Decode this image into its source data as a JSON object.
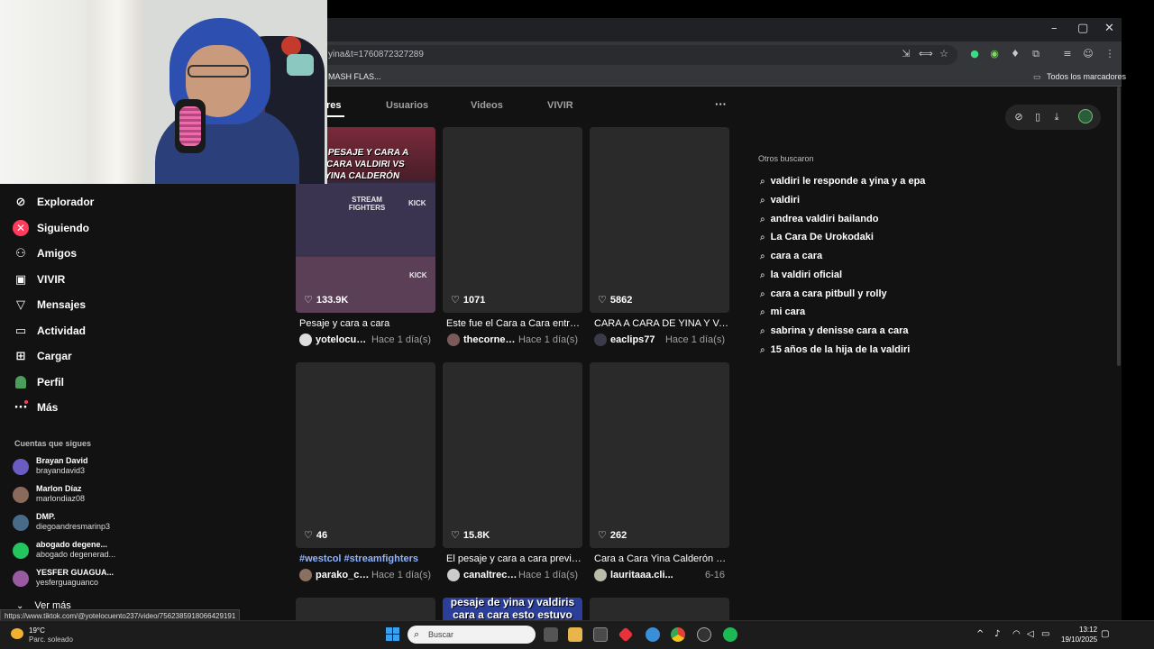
{
  "browser": {
    "url_fragment": "yina&t=1760872327289",
    "bookmark_left": "MASH FLAS...",
    "bookmark_right": "Todos los marcadores",
    "window_controls": [
      "–",
      "▢",
      "✕"
    ]
  },
  "tabs": [
    {
      "label": "res",
      "active": true
    },
    {
      "label": "Usuarios",
      "active": false
    },
    {
      "label": "Videos",
      "active": false
    },
    {
      "label": "VIVIR",
      "active": false
    }
  ],
  "tabs_more": "···",
  "videos": [
    {
      "likes": "133.9K",
      "title": "Pesaje y cara a cara",
      "author": "yotelocuent...",
      "date": "Hace 1 día(s)",
      "headline": "PESAJE Y CARA A CARA VALDIRI VS YINA CALDERÓN",
      "kick": "KICK",
      "stream": "STREAM FIGHTERS"
    },
    {
      "likes": "1071",
      "title": "Este fue el Cara a Cara entre...",
      "author": "thecornertv_",
      "date": "Hace 1 día(s)"
    },
    {
      "likes": "5862",
      "title": "CARA A CARA DE YINA Y VA...",
      "author": "eaclips77",
      "date": "Hace 1 día(s)"
    },
    {
      "likes": "46",
      "title": "#westcol #streamfighters",
      "author": "parako_clips",
      "date": "Hace 1 día(s)"
    },
    {
      "likes": "15.8K",
      "title": "El pesaje y cara a cara previo...",
      "author": "canaltrececo",
      "date": "Hace 1 día(s)"
    },
    {
      "likes": "262",
      "title": "Cara a Cara Yina Calderón vs...",
      "author": "lauritaaa.cli...",
      "date": "6-16"
    }
  ],
  "row3_overlay": "pesaje de yina y valdiris cara a cara esto estuvo",
  "related": {
    "title": "Otros buscaron",
    "items": [
      "valdiri le responde a yina y a epa",
      "valdiri",
      "andrea valdiri bailando",
      "La Cara De Urokodaki",
      "cara a cara",
      "la valdiri oficial",
      "cara a cara pitbull y rolly",
      "mi cara",
      "sabrina y denisse cara a cara",
      "15 años de la hija de la valdiri"
    ]
  },
  "nav": {
    "items": [
      {
        "label": "Explorador",
        "icon": "compass-icon"
      },
      {
        "label": "Siguiendo",
        "icon": "following-icon"
      },
      {
        "label": "Amigos",
        "icon": "friends-icon"
      },
      {
        "label": "VIVIR",
        "icon": "live-icon"
      },
      {
        "label": "Mensajes",
        "icon": "messages-icon"
      },
      {
        "label": "Actividad",
        "icon": "activity-icon"
      },
      {
        "label": "Cargar",
        "icon": "upload-icon"
      },
      {
        "label": "Perfil",
        "icon": "profile-icon"
      },
      {
        "label": "Más",
        "icon": "more-icon"
      }
    ],
    "following_label": "Cuentas que sigues",
    "following": [
      {
        "name": "Brayan David",
        "user": "brayandavid3",
        "color": "#6a5cc0"
      },
      {
        "name": "Marlon Díaz",
        "user": "marlondiaz08",
        "color": "#8a6a5a"
      },
      {
        "name": "DMP.",
        "user": "diegoandresmarinp3",
        "color": "#4a6a8a"
      },
      {
        "name": "abogado degene...",
        "user": "abogado degenerad...",
        "color": "#22c55e"
      },
      {
        "name": "YESFER GUAGUA...",
        "user": "yesferguaguanco",
        "color": "#9a5aa0"
      }
    ],
    "ver_mas": "Ver más"
  },
  "status_link": "https://www.tiktok.com/@yotelocuento237/video/7562385918066429191",
  "taskbar": {
    "temp": "19°C",
    "weather": "Parc. soleado",
    "search_placeholder": "Buscar",
    "time": "13:12",
    "date": "19/10/2025"
  },
  "colors": {
    "accent": "#ff3b5c",
    "page_bg": "#121212",
    "card_bg": "#2a2a2a"
  }
}
